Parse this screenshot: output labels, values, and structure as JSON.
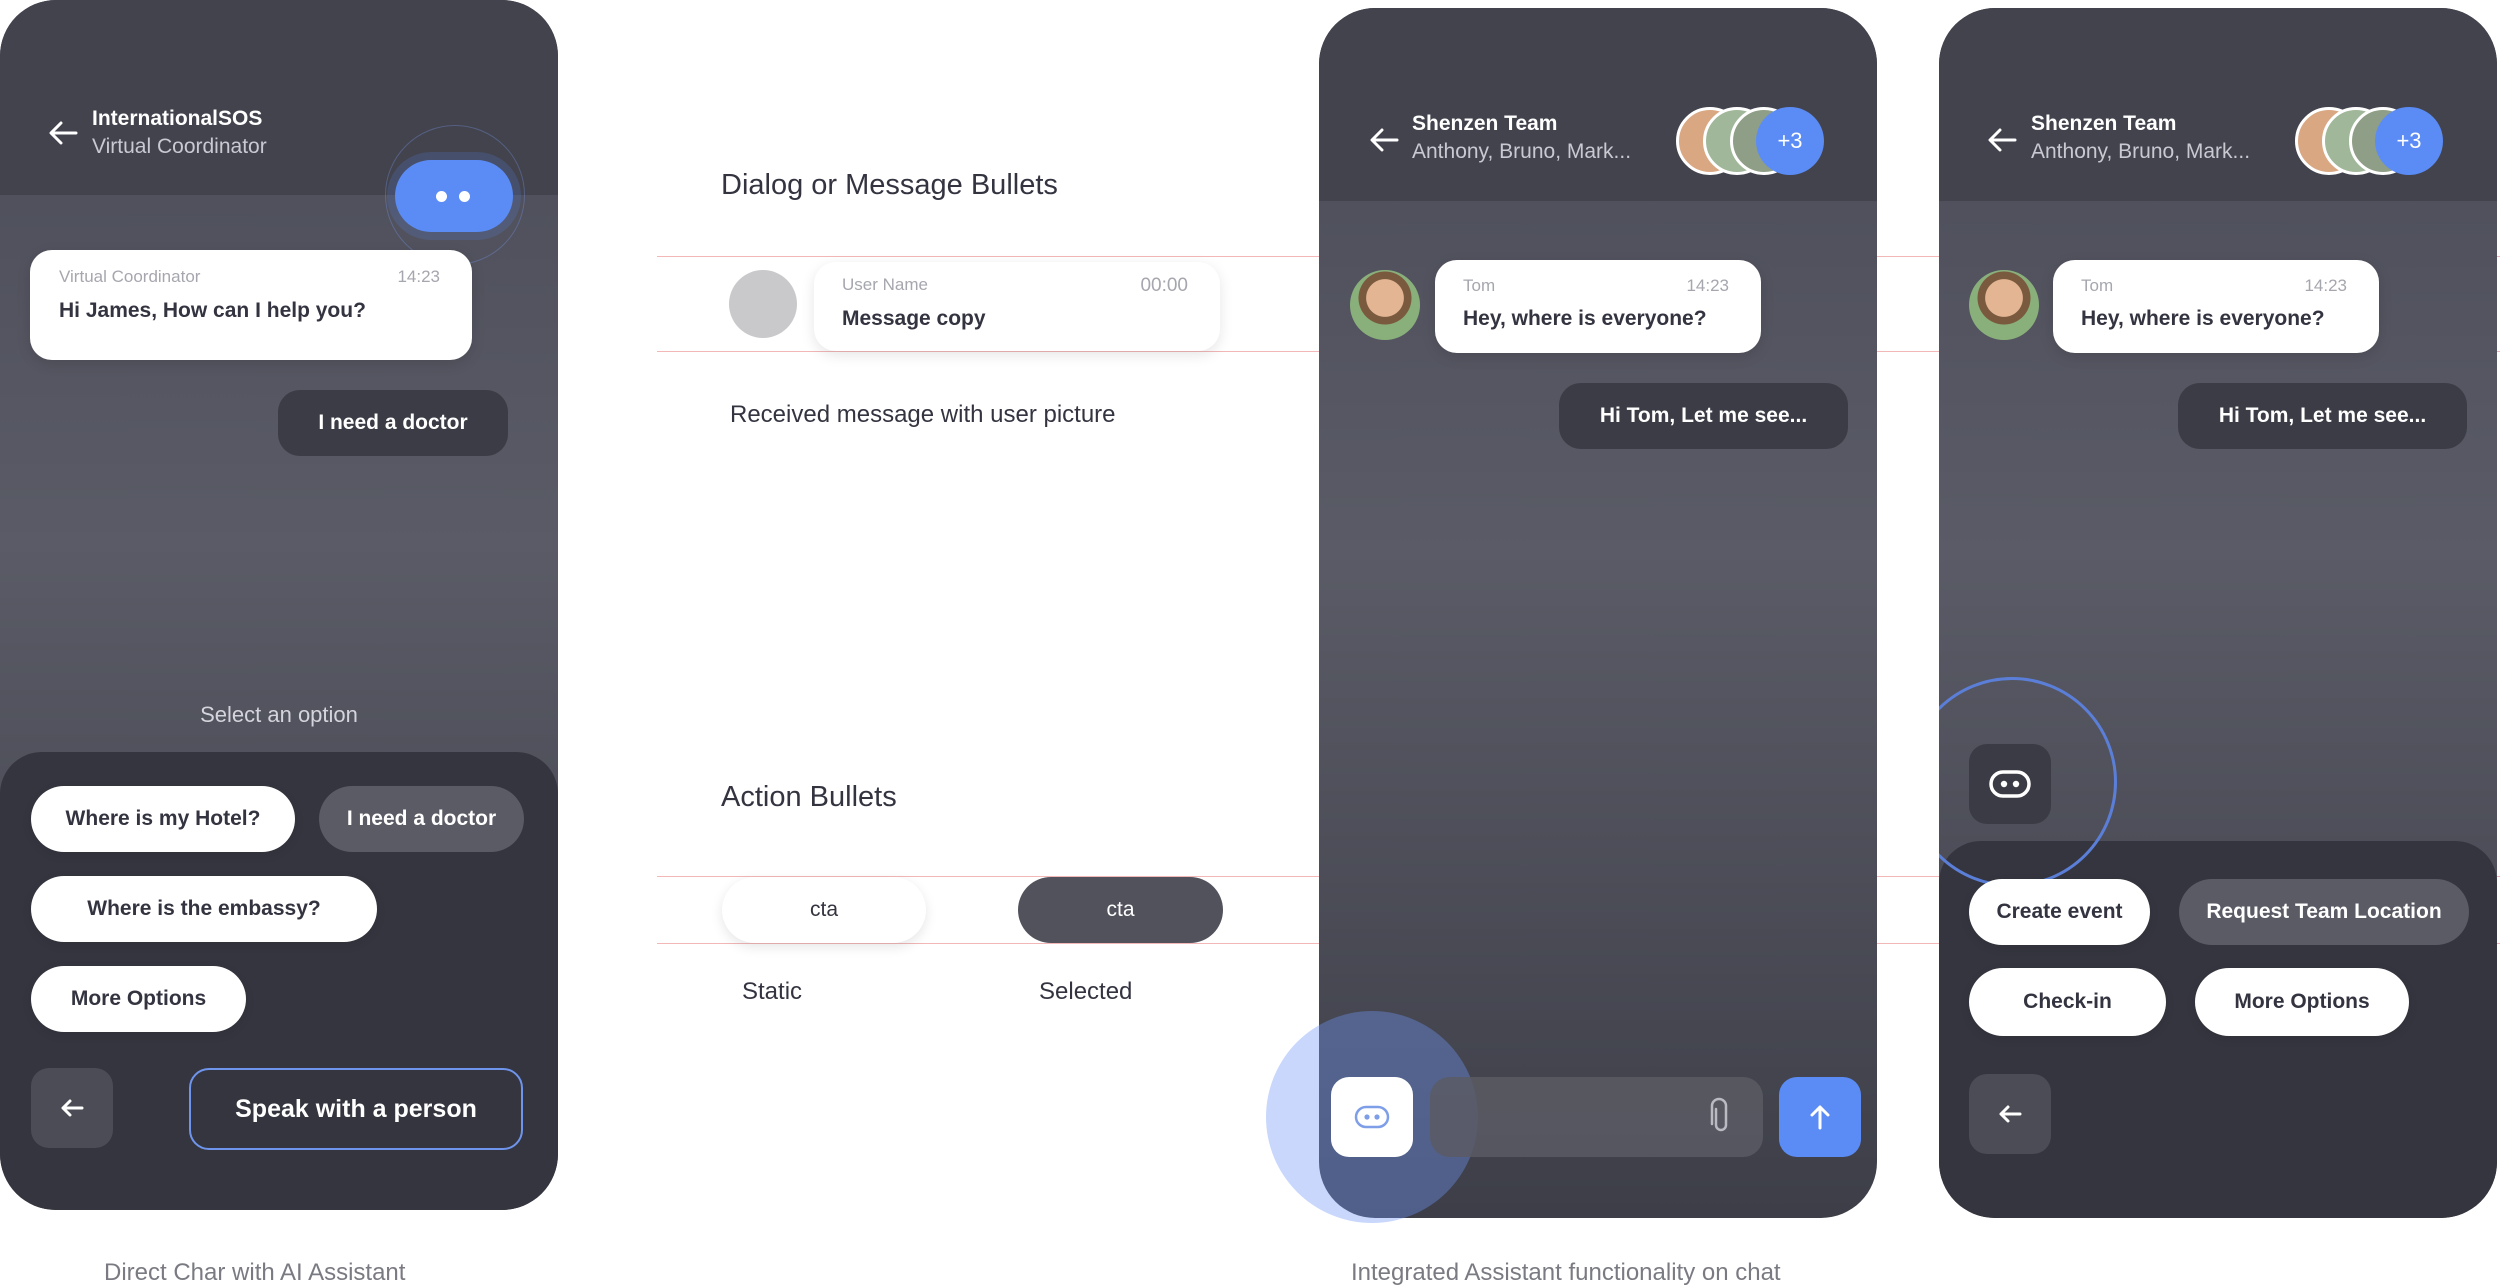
{
  "phone1": {
    "title": "InternationalSOS",
    "subtitle": "Virtual Coordinator",
    "received": {
      "sender": "Virtual Coordinator",
      "time": "14:23",
      "text": "Hi James, How can I help you?"
    },
    "sent": "I need a doctor",
    "prompt": "Select an option",
    "options": {
      "hotel": "Where is my Hotel?",
      "doctor": "I need a doctor",
      "embassy": "Where is the embassy?",
      "more": "More Options"
    },
    "speak_button": "Speak with a person",
    "accent": "#5b8cf5"
  },
  "spec": {
    "dialog_title": "Dialog or Message Bullets",
    "sample": {
      "user": "User Name",
      "time": "00:00",
      "text": "Message copy"
    },
    "received_label": "Received message with user picture",
    "action_title": "Action Bullets",
    "cta_static": "cta",
    "cta_selected": "cta",
    "static_label": "Static",
    "selected_label": "Selected"
  },
  "phone2": {
    "title": "Shenzen Team",
    "subtitle": "Anthony, Bruno, Mark...",
    "more_count": "+3",
    "received": {
      "sender": "Tom",
      "time": "14:23",
      "text": "Hey, where is everyone?"
    },
    "sent": "Hi Tom, Let me see..."
  },
  "phone3": {
    "title": "Shenzen Team",
    "subtitle": "Anthony, Bruno, Mark...",
    "more_count": "+3",
    "received": {
      "sender": "Tom",
      "time": "14:23",
      "text": "Hey, where is everyone?"
    },
    "sent": "Hi Tom, Let me see...",
    "options": {
      "create": "Create event",
      "location": "Request Team Location",
      "checkin": "Check-in",
      "more": "More Options"
    }
  },
  "captions": {
    "left": "Direct Char with AI Assistant",
    "right": "Integrated Assistant functionality on chat"
  }
}
